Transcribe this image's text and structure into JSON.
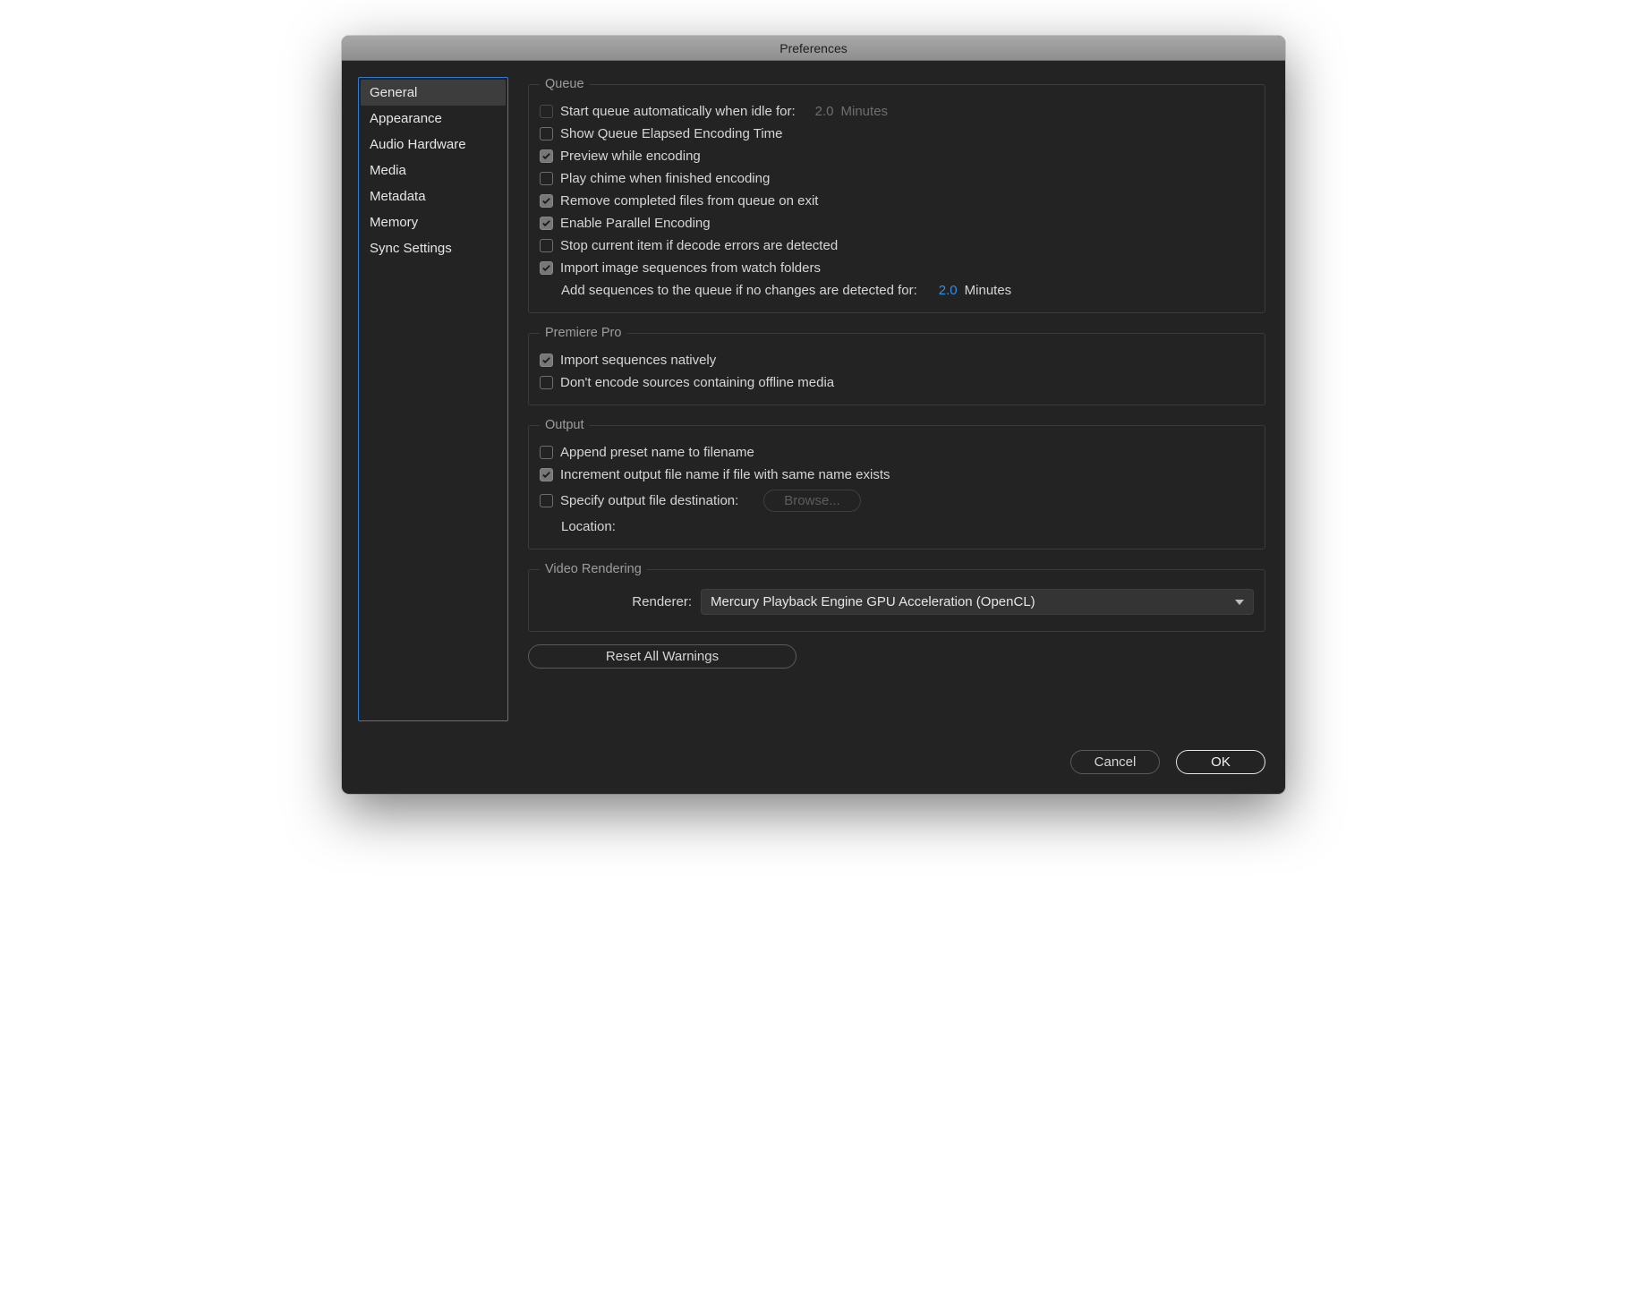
{
  "title": "Preferences",
  "sidebar": {
    "items": [
      {
        "label": "General",
        "selected": true
      },
      {
        "label": "Appearance"
      },
      {
        "label": "Audio Hardware"
      },
      {
        "label": "Media"
      },
      {
        "label": "Metadata"
      },
      {
        "label": "Memory"
      },
      {
        "label": "Sync Settings"
      }
    ]
  },
  "queue": {
    "legend": "Queue",
    "start_idle": {
      "checked": false,
      "label": "Start queue automatically when idle for:",
      "value": "2.0",
      "unit": "Minutes"
    },
    "show_elapsed": {
      "checked": false,
      "label": "Show Queue Elapsed Encoding Time"
    },
    "preview": {
      "checked": true,
      "label": "Preview while encoding"
    },
    "chime": {
      "checked": false,
      "label": "Play chime when finished encoding"
    },
    "remove_completed": {
      "checked": true,
      "label": "Remove completed files from queue on exit"
    },
    "parallel": {
      "checked": true,
      "label": "Enable Parallel Encoding"
    },
    "stop_decode_errors": {
      "checked": false,
      "label": "Stop current item if decode errors are detected"
    },
    "import_image_seq": {
      "checked": true,
      "label": "Import image sequences from watch folders"
    },
    "add_seq": {
      "label": "Add sequences to the queue if no changes are detected for:",
      "value": "2.0",
      "unit": "Minutes"
    }
  },
  "premiere": {
    "legend": "Premiere Pro",
    "import_native": {
      "checked": true,
      "label": "Import sequences natively"
    },
    "dont_encode_offline": {
      "checked": false,
      "label": "Don't encode sources containing offline media"
    }
  },
  "output": {
    "legend": "Output",
    "append_preset": {
      "checked": false,
      "label": "Append preset name to filename"
    },
    "increment": {
      "checked": true,
      "label": "Increment output file name if file with same name exists"
    },
    "specify_dest": {
      "checked": false,
      "label": "Specify output file destination:"
    },
    "browse": "Browse...",
    "location_label": "Location:"
  },
  "video": {
    "legend": "Video Rendering",
    "renderer_label": "Renderer:",
    "renderer_value": "Mercury Playback Engine GPU Acceleration (OpenCL)"
  },
  "reset_warnings": "Reset All Warnings",
  "cancel": "Cancel",
  "ok": "OK"
}
